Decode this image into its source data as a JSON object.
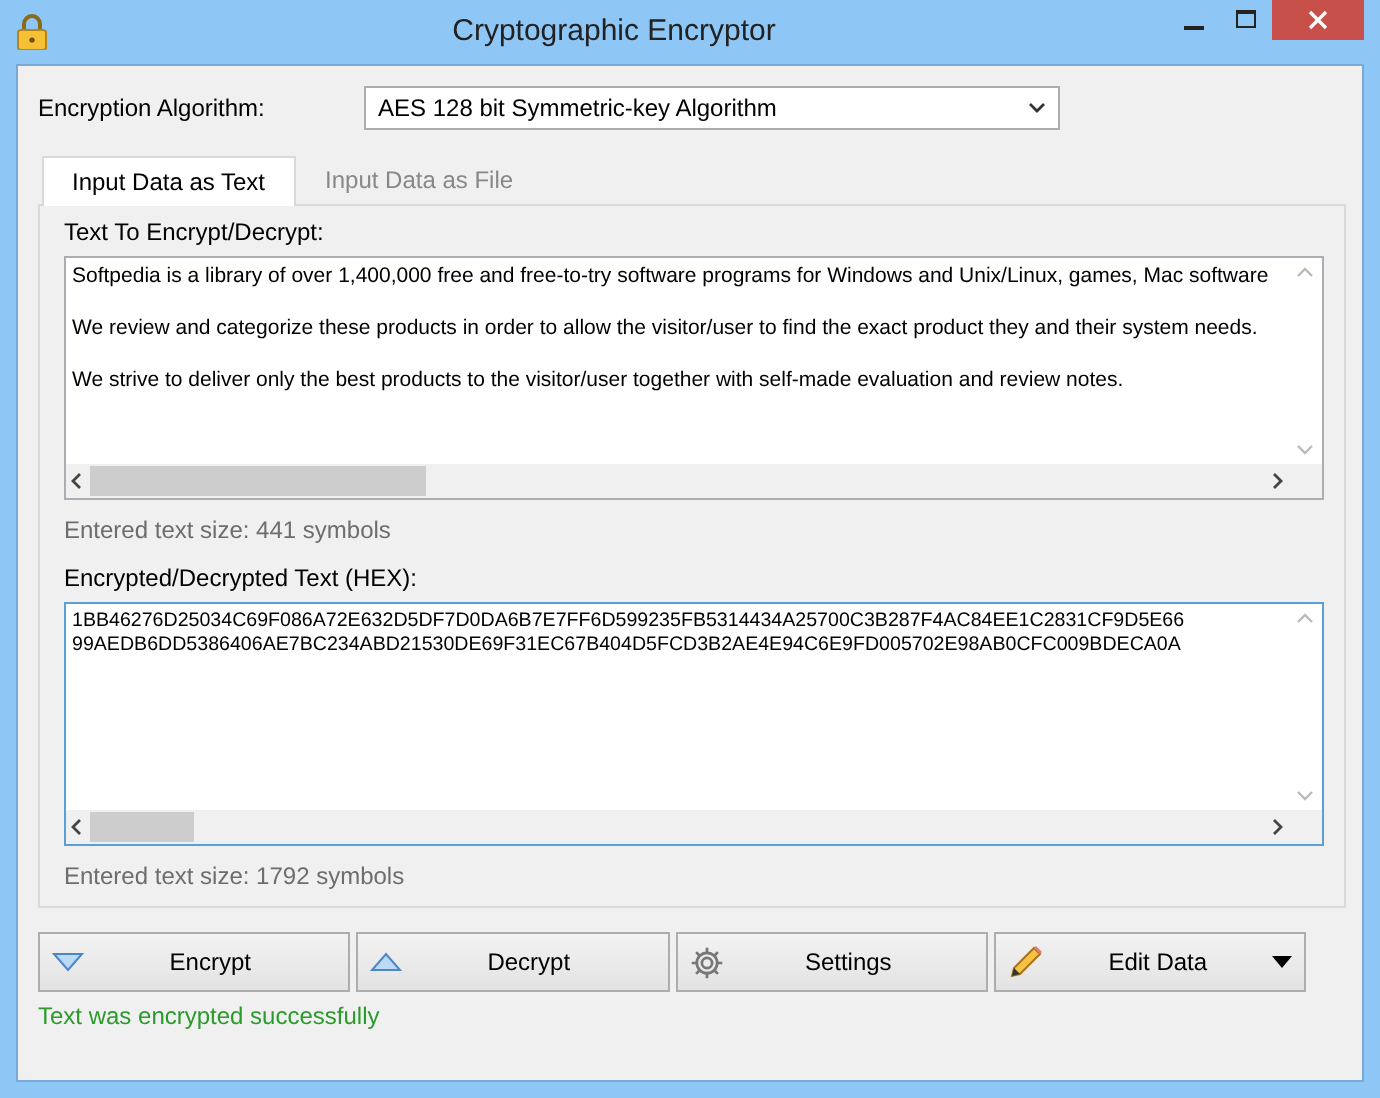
{
  "window": {
    "title": "Cryptographic Encryptor"
  },
  "algorithm": {
    "label": "Encryption Algorithm:",
    "value": "AES 128 bit Symmetric-key Algorithm"
  },
  "tabs": [
    {
      "label": "Input Data as Text",
      "selected": true
    },
    {
      "label": "Input Data as File",
      "selected": false
    }
  ],
  "input": {
    "label": "Text To Encrypt/Decrypt:",
    "lines": [
      "Softpedia is a library of over 1,400,000 free and free-to-try software programs for Windows and Unix/Linux, games, Mac software",
      "We review and categorize these products in order to allow the visitor/user to find the exact product they and their system needs.",
      "We strive to deliver only the best products to the visitor/user together with self-made evaluation and review notes."
    ],
    "size": "Entered text size: 441 symbols"
  },
  "output": {
    "label": "Encrypted/Decrypted Text (HEX):",
    "lines": [
      "1BB46276D25034C69F086A72E632D5DF7D0DA6B7E7FF6D599235FB5314434A25700C3B287F4AC84EE1C2831CF9D5E66",
      "99AEDB6DD5386406AE7BC234ABD21530DE69F31EC67B404D5FCD3B2AE4E94C6E9FD005702E98AB0CFC009BDECA0A"
    ],
    "size": "Entered text size: 1792 symbols"
  },
  "buttons": [
    {
      "label": "Encrypt",
      "kind": "down"
    },
    {
      "label": "Decrypt",
      "kind": "up"
    },
    {
      "label": "Settings",
      "kind": "gear"
    },
    {
      "label": "Edit Data",
      "kind": "pencil"
    }
  ],
  "status": "Text was encrypted successfully"
}
